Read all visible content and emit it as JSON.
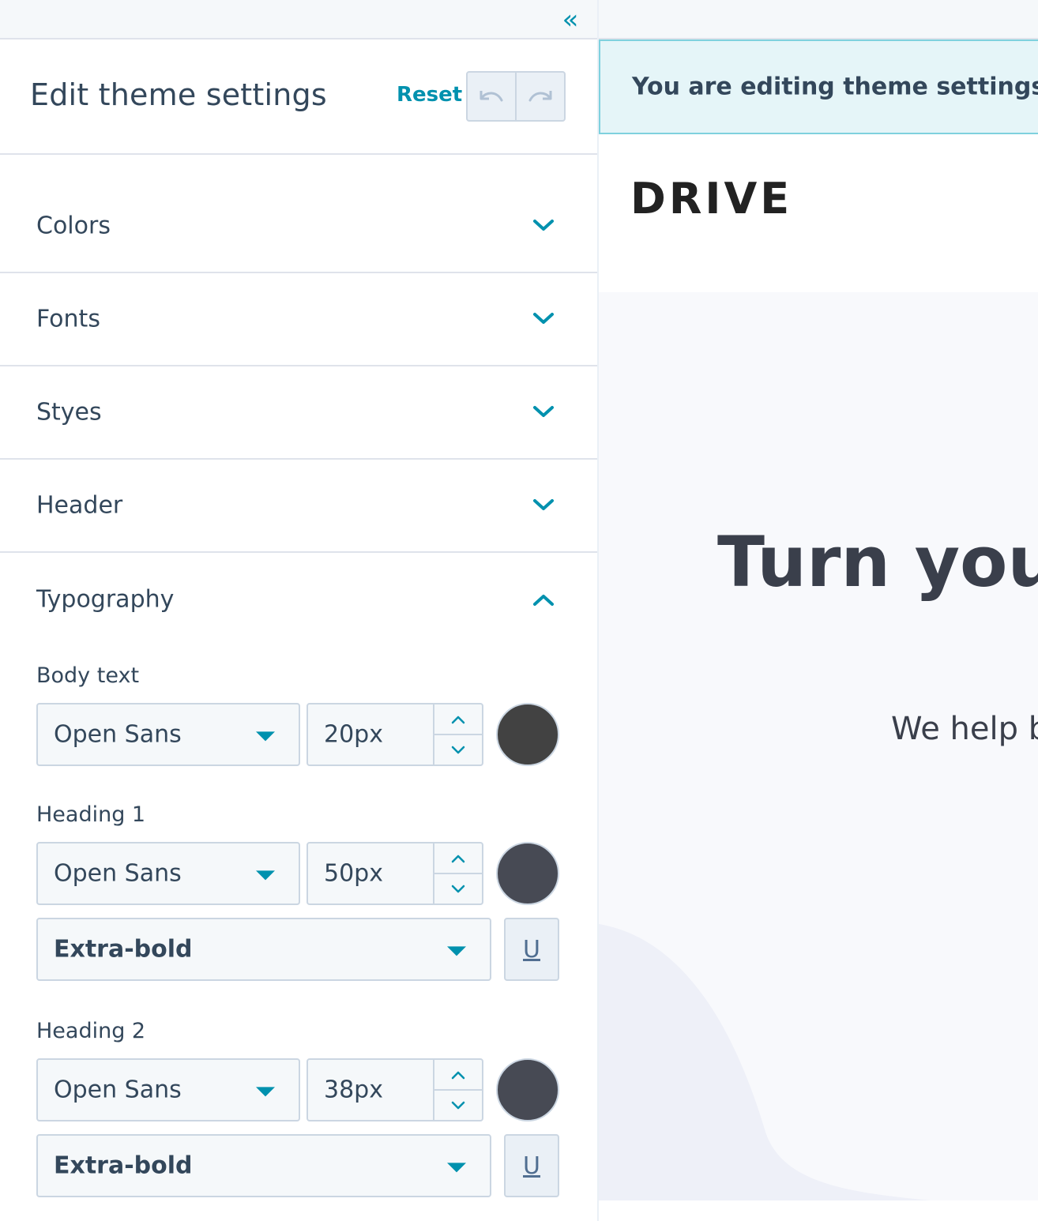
{
  "panel": {
    "title": "Edit theme settings",
    "reset_label": "Reset",
    "collapse_glyph": "«"
  },
  "sections": [
    {
      "label": "Colors",
      "expanded": false
    },
    {
      "label": "Fonts",
      "expanded": false
    },
    {
      "label": "Styes",
      "expanded": false
    },
    {
      "label": "Header",
      "expanded": false
    },
    {
      "label": "Typography",
      "expanded": true
    }
  ],
  "typography": {
    "body": {
      "label": "Body text",
      "font": "Open Sans",
      "size": "20px",
      "color": "#424242"
    },
    "h1": {
      "label": "Heading 1",
      "font": "Open Sans",
      "size": "50px",
      "color": "#474a54",
      "weight": "Extra-bold",
      "underline_glyph": "U"
    },
    "h2": {
      "label": "Heading 2",
      "font": "Open Sans",
      "size": "38px",
      "color": "#474a54",
      "weight": "Extra-bold",
      "underline_glyph": "U"
    }
  },
  "preview": {
    "banner_text": "You are editing theme settings.",
    "logo": "DRIVE",
    "hero_title": "Turn your",
    "hero_subtitle": "We help b"
  },
  "colors": {
    "accent": "#0091ae",
    "text": "#33475b",
    "border": "#cbd6e2",
    "banner_bg": "#e5f5f8"
  }
}
